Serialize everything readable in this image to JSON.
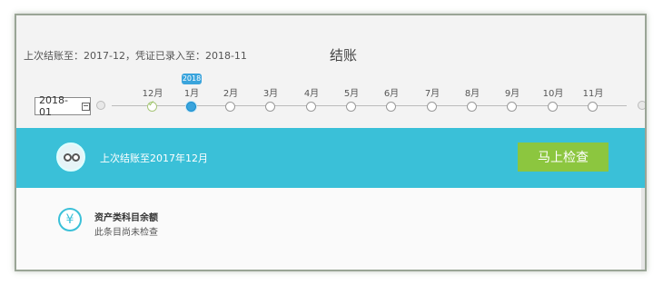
{
  "header": {
    "status_text": "上次结账至：2017-12，凭证已录入至：2018-11",
    "title": "结账"
  },
  "period_picker": {
    "value": "2018-01",
    "year_badge": "2018",
    "months": [
      {
        "label": "12月",
        "state": "done"
      },
      {
        "label": "1月",
        "state": "current"
      },
      {
        "label": "2月",
        "state": "pending"
      },
      {
        "label": "3月",
        "state": "pending"
      },
      {
        "label": "4月",
        "state": "pending"
      },
      {
        "label": "5月",
        "state": "pending"
      },
      {
        "label": "6月",
        "state": "pending"
      },
      {
        "label": "7月",
        "state": "pending"
      },
      {
        "label": "8月",
        "state": "pending"
      },
      {
        "label": "9月",
        "state": "pending"
      },
      {
        "label": "10月",
        "state": "pending"
      },
      {
        "label": "11月",
        "state": "pending"
      }
    ]
  },
  "banner": {
    "text": "上次结账至2017年12月",
    "button_label": "马上检查"
  },
  "check_items": [
    {
      "title": "资产类科目余额",
      "status": "此条目尚未检查",
      "icon": "yen-icon"
    }
  ],
  "colors": {
    "accent": "#3ac0d8",
    "button": "#8cc63f",
    "current_month": "#3aa4dc"
  }
}
